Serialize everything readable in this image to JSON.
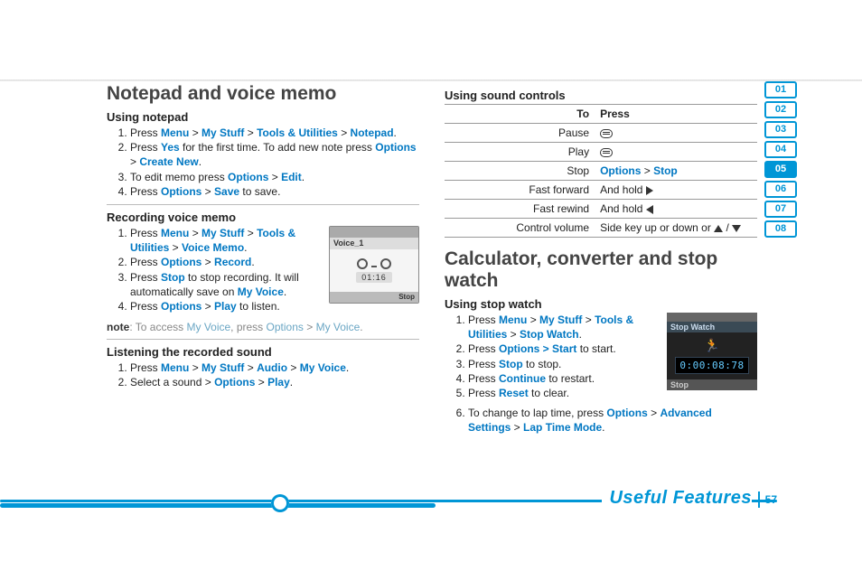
{
  "meta": {
    "page_number": "57",
    "footer_label": "Useful Features"
  },
  "tabs": {
    "items": [
      "01",
      "02",
      "03",
      "04",
      "05",
      "06",
      "07",
      "08"
    ],
    "active": "05"
  },
  "col1": {
    "h1": "Notepad and voice memo",
    "notepad": {
      "h2": "Using notepad",
      "s1a": "Press ",
      "k1": "Menu",
      "k2": "My Stuff",
      "k3": "Tools & Utilities",
      "k4": "Notepad",
      "s1b": ".",
      "s2a": "Press ",
      "k5": "Yes",
      "s2b": " for the first time. To add new note press ",
      "k6": "Options",
      "k7": "Create New",
      "s2c": ".",
      "s3a": "To edit memo press ",
      "k8": "Options",
      "k9": "Edit",
      "s3b": ".",
      "s4a": "Press ",
      "k10": "Options",
      "k11": "Save",
      "s4b": " to save."
    },
    "recording": {
      "h2": "Recording voice memo",
      "s1a": "Press ",
      "k1": "Menu",
      "k2": "My Stuff",
      "k3": "Tools & Utilities",
      "k4": "Voice Memo",
      "s1b": ".",
      "s2a": "Press ",
      "k5": "Options",
      "k6": "Record",
      "s2b": ".",
      "s3a": "Press ",
      "k7": "Stop",
      "s3b": " to stop recording. It will automatically save on ",
      "k8": "My Voice",
      "s3c": ".",
      "s4a": "Press ",
      "k9": "Options",
      "k10": "Play",
      "s4b": " to listen.",
      "shot": {
        "title": "Voice_1",
        "time": "01:16",
        "foot": "Stop"
      }
    },
    "note": {
      "lead": "note",
      "a": ": To access ",
      "l1": "My Voice",
      "b": ", press ",
      "l2": "Options",
      "c": " > ",
      "l3": "My Voice",
      "d": "."
    },
    "listening": {
      "h2": "Listening the recorded sound",
      "s1a": "Press ",
      "k1": "Menu",
      "k2": "My Stuff",
      "k3": "Audio",
      "k4": "My Voice",
      "s1b": ".",
      "s2a": "Select a sound > ",
      "k5": "Options",
      "k6": "Play",
      "s2b": "."
    }
  },
  "col2": {
    "sound": {
      "h2": "Using sound controls",
      "head_to": "To",
      "head_press": "Press",
      "r1a": "Pause",
      "r2a": "Play",
      "r3a": "Stop",
      "r3b1": "Options",
      "r3b2": "Stop",
      "r4a": "Fast forward",
      "r4b": "And hold ",
      "r5a": "Fast rewind",
      "r5b": "And hold ",
      "r6a": "Control volume",
      "r6b": "Side key up or down or "
    },
    "h1": "Calculator, converter and stop watch",
    "stopwatch": {
      "h2": "Using stop watch",
      "s1a": "Press ",
      "k1": "Menu",
      "k2": "My Stuff",
      "k3": "Tools & Utilities",
      "k4": "Stop Watch",
      "s1b": ".",
      "s2a": "Press ",
      "k5": "Options > Start",
      "s2b": " to start.",
      "s3a": "Press ",
      "k6": "Stop",
      "s3b": " to stop.",
      "s4a": "Press ",
      "k7": "Continue",
      "s4b": " to restart.",
      "s5a": "Press ",
      "k8": "Reset",
      "s5b": " to clear.",
      "s6a": "To change to lap time, press ",
      "k9": "Options",
      "k10": "Advanced Settings",
      "k11": "Lap Time Mode",
      "s6b": ".",
      "shot": {
        "title": "Stop Watch",
        "time": "0:00:08:78",
        "foot": "Stop"
      }
    }
  }
}
